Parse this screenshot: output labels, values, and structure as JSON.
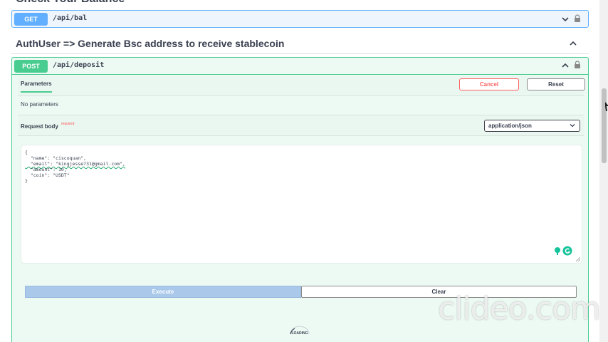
{
  "top_section": {
    "heading_clipped": "Check Your Balance"
  },
  "get_operation": {
    "method": "GET",
    "path": "/api/bal"
  },
  "tag": {
    "title": "AuthUser => Generate Bsc address to receive stablecoin"
  },
  "post_operation": {
    "method": "POST",
    "path": "/api/deposit",
    "parameters_tab": "Parameters",
    "cancel_label": "Cancel",
    "reset_label": "Reset",
    "no_parameters": "No parameters",
    "request_body_label": "Request body",
    "required_label": "required",
    "content_type": "application/json",
    "body_lines": [
      "{",
      "  \"name\": \"ciscoquan\",",
      "  \"email\": \"kingjesse731@gmail.com\",",
      "  \"amount\": 10,",
      "  \"coin\": \"USDT\"",
      "}"
    ],
    "execute_label": "Execute",
    "clear_label": "Clear",
    "loading_label": "LOADING"
  },
  "watermark": "clideo.com",
  "colors": {
    "get": "#61affe",
    "post": "#49cc90",
    "cancel": "#ff6060"
  },
  "icons": [
    "chevron-down-icon",
    "chevron-up-icon",
    "lock-icon",
    "grammarly-icon",
    "spinner-icon"
  ]
}
